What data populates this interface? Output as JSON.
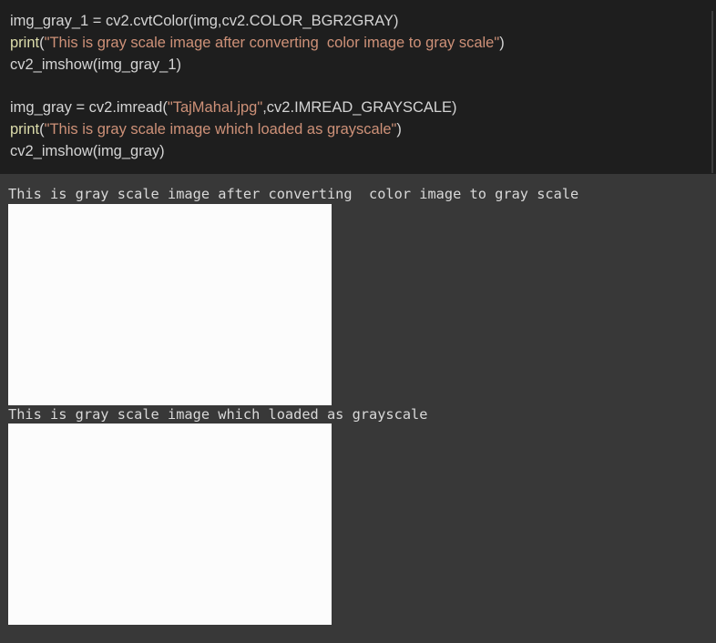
{
  "code_cell": {
    "lines": [
      [
        {
          "t": "img_gray_1 = cv2.cvtColor(img,cv2.COLOR_BGR2GRAY)",
          "c": "plain"
        }
      ],
      [
        {
          "t": "print",
          "c": "kw"
        },
        {
          "t": "(",
          "c": "plain"
        },
        {
          "t": "\"This is gray scale image after converting  color image to gray scale\"",
          "c": "str"
        },
        {
          "t": ")",
          "c": "plain"
        }
      ],
      [
        {
          "t": "cv2_imshow(img_gray_1)",
          "c": "plain"
        }
      ],
      [],
      [
        {
          "t": "img_gray = cv2.imread(",
          "c": "plain"
        },
        {
          "t": "\"TajMahal.jpg\"",
          "c": "str"
        },
        {
          "t": ",cv2.IMREAD_GRAYSCALE)",
          "c": "plain"
        }
      ],
      [
        {
          "t": "print",
          "c": "kw"
        },
        {
          "t": "(",
          "c": "plain"
        },
        {
          "t": "\"This is gray scale image which loaded as grayscale\"",
          "c": "str"
        },
        {
          "t": ")",
          "c": "plain"
        }
      ],
      [
        {
          "t": "cv2_imshow(img_gray)",
          "c": "plain"
        }
      ]
    ]
  },
  "output": {
    "text_1": "This is gray scale image after converting  color image to gray scale",
    "image_1": "taj-mahal-grayscale-image",
    "text_2": "This is gray scale image which loaded as grayscale",
    "image_2": "taj-mahal-grayscale-image"
  },
  "colors": {
    "code_bg": "#1e1e1e",
    "output_bg": "#383838",
    "keyword": "#dcdcaa",
    "string": "#ce9178",
    "text": "#d4d4d4"
  }
}
